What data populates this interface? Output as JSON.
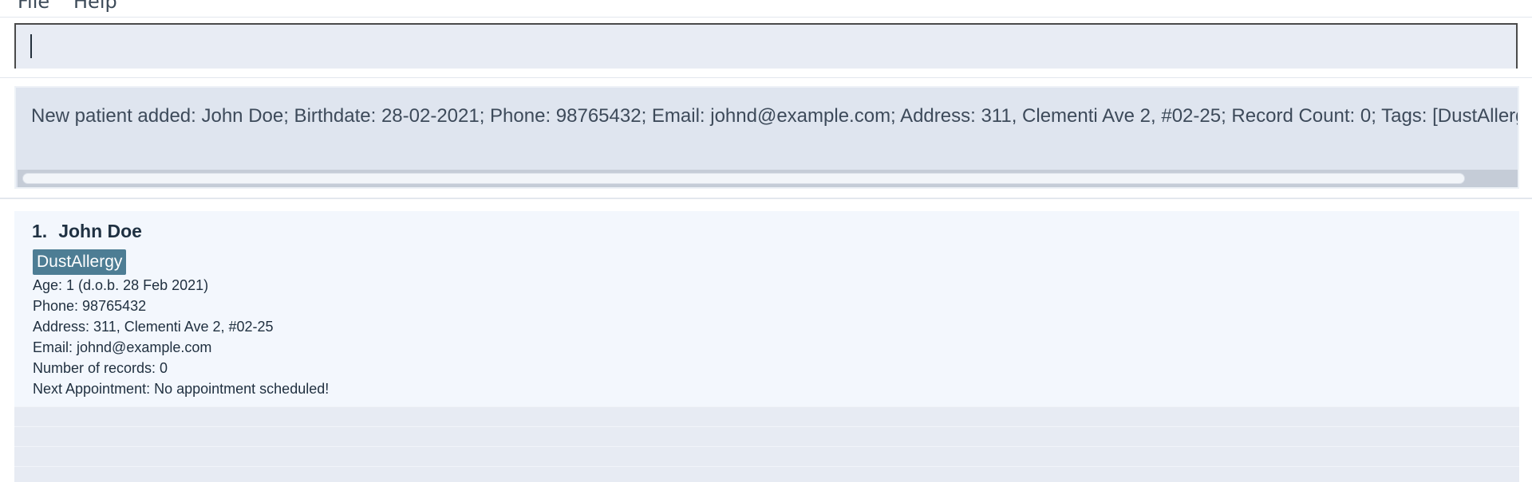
{
  "menu": {
    "file_label": "File",
    "help_label": "Help"
  },
  "command": {
    "value": "",
    "placeholder": ""
  },
  "result": {
    "message": "New patient added: John Doe; Birthdate: 28-02-2021; Phone: 98765432; Email: johnd@example.com; Address: 311, Clementi Ave 2, #02-25; Record Count: 0; Tags: [DustAllergy]"
  },
  "patients": [
    {
      "index": "1.",
      "name": "John Doe",
      "tags": [
        "DustAllergy"
      ],
      "age_line": "Age: 1   (d.o.b. 28 Feb 2021)",
      "phone_line": "Phone: 98765432",
      "address_line": "Address: 311, Clementi Ave 2, #02-25",
      "email_line": "Email: johnd@example.com",
      "records_line": "Number of records: 0",
      "appointment_line": "Next Appointment: No appointment scheduled!"
    }
  ],
  "colors": {
    "tag_background": "#4d7d94",
    "card_background": "#f3f7fd",
    "result_background": "#dfe5ef"
  }
}
